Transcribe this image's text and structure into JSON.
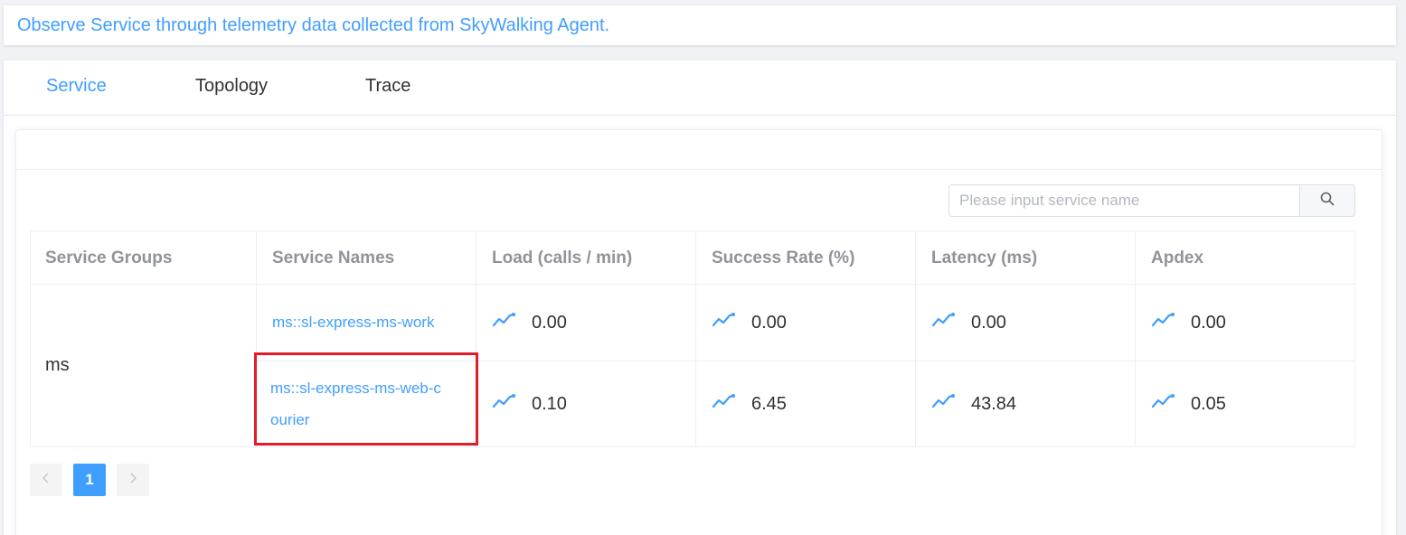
{
  "description": "Observe Service through telemetry data collected from SkyWalking Agent.",
  "tabs": [
    {
      "label": "Service",
      "active": true
    },
    {
      "label": "Topology",
      "active": false
    },
    {
      "label": "Trace",
      "active": false
    }
  ],
  "search": {
    "placeholder": "Please input service name",
    "icon": "search-icon"
  },
  "table": {
    "columns": [
      "Service Groups",
      "Service Names",
      "Load (calls / min)",
      "Success Rate (%)",
      "Latency (ms)",
      "Apdex"
    ],
    "group": "ms",
    "rows": [
      {
        "service_line1": "ms::sl-express-ms-work",
        "service_line2": "",
        "load": "0.00",
        "success_rate": "0.00",
        "latency": "0.00",
        "apdex": "0.00"
      },
      {
        "service_line1": "ms::sl-express-ms-web-c",
        "service_line2": "ourier",
        "load": "0.10",
        "success_rate": "6.45",
        "latency": "43.84",
        "apdex": "0.05"
      }
    ],
    "metric_icon": "trend-line-icon"
  },
  "pagination": {
    "prev_icon": "chevron-left-icon",
    "current_page": "1",
    "next_icon": "chevron-right-icon"
  },
  "colors": {
    "accent": "#409eff",
    "highlight_box": "#e01d2a"
  }
}
